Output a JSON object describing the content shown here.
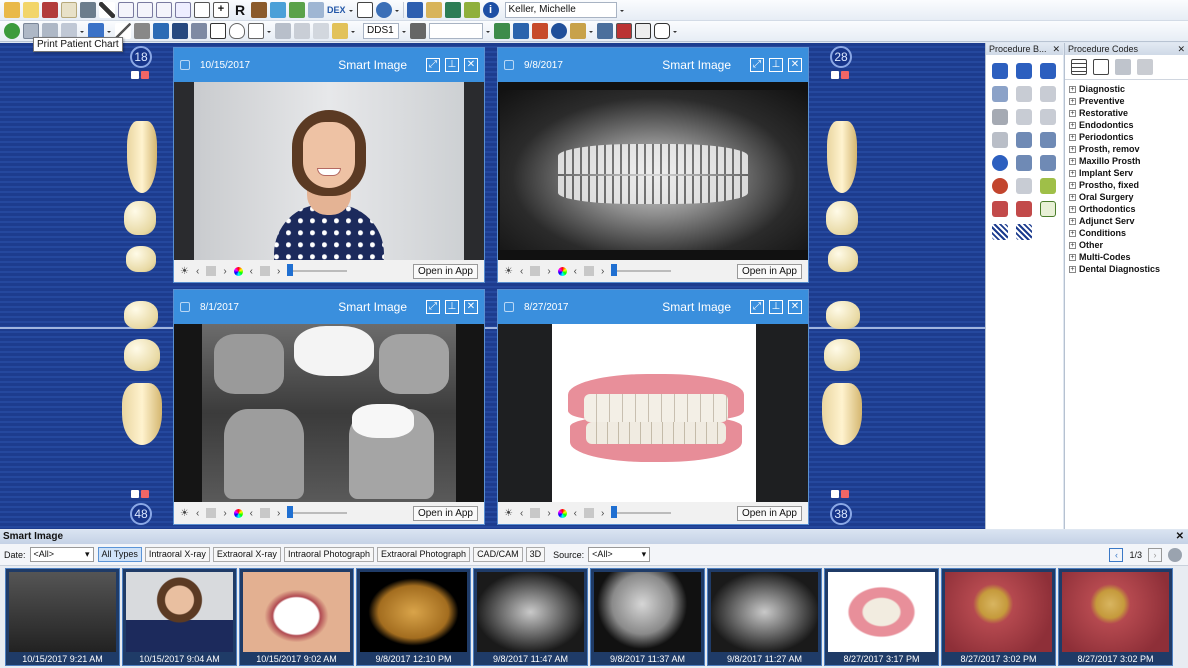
{
  "toolbar": {
    "dex_label": "DEX",
    "patient_name": "Keller, Michelle",
    "provider": "DDS1",
    "tooltip": "Print Patient Chart"
  },
  "chart": {
    "tooth_numbers": {
      "upper_left": "18",
      "upper_right": "28",
      "lower_left": "48",
      "lower_right": "38"
    }
  },
  "panels": [
    {
      "date": "10/15/2017",
      "title": "Smart Image",
      "open_label": "Open in App",
      "type": "photo-portrait"
    },
    {
      "date": "9/8/2017",
      "title": "Smart Image",
      "open_label": "Open in App",
      "type": "panoramic-xray"
    },
    {
      "date": "8/1/2017",
      "title": "Smart Image",
      "open_label": "Open in App",
      "type": "bitewing-xray"
    },
    {
      "date": "8/27/2017",
      "title": "Smart Image",
      "open_label": "Open in App",
      "type": "denture-model"
    }
  ],
  "procedure_buttons": {
    "title": "Procedure B..."
  },
  "procedure_codes": {
    "title": "Procedure Codes",
    "items": [
      "Diagnostic",
      "Preventive",
      "Restorative",
      "Endodontics",
      "Periodontics",
      "Prosth, remov",
      "Maxillo Prosth",
      "Implant Serv",
      "Prostho, fixed",
      "Oral Surgery",
      "Orthodontics",
      "Adjunct Serv",
      "Conditions",
      "Other",
      "Multi-Codes",
      "Dental Diagnostics"
    ]
  },
  "smart_image": {
    "title": "Smart Image",
    "date_label": "Date:",
    "date_value": "<All>",
    "filters": [
      "All Types",
      "Intraoral X-ray",
      "Extraoral X-ray",
      "Intraoral Photograph",
      "Extraoral Photograph",
      "CAD/CAM",
      "3D"
    ],
    "active_filter": "All Types",
    "source_label": "Source:",
    "source_value": "<All>",
    "page": "1/3",
    "thumbnails": [
      {
        "caption": "10/15/2017 9:21 AM",
        "kind": "bitewing-set"
      },
      {
        "caption": "10/15/2017 9:04 AM",
        "kind": "portrait"
      },
      {
        "caption": "10/15/2017 9:02 AM",
        "kind": "smile"
      },
      {
        "caption": "9/8/2017 12:10 PM",
        "kind": "skull-3d"
      },
      {
        "caption": "9/8/2017 11:47 AM",
        "kind": "panoramic"
      },
      {
        "caption": "9/8/2017 11:37 AM",
        "kind": "ceph"
      },
      {
        "caption": "9/8/2017 11:27 AM",
        "kind": "panoramic"
      },
      {
        "caption": "8/27/2017 3:17 PM",
        "kind": "denture"
      },
      {
        "caption": "8/27/2017 3:02 PM",
        "kind": "intraoral"
      },
      {
        "caption": "8/27/2017 3:02 PM",
        "kind": "intraoral"
      }
    ]
  },
  "colors": {
    "accent": "#3a8fdd",
    "chart_bg": "#1d3c8e",
    "panel_header": "#3a8fdd"
  }
}
